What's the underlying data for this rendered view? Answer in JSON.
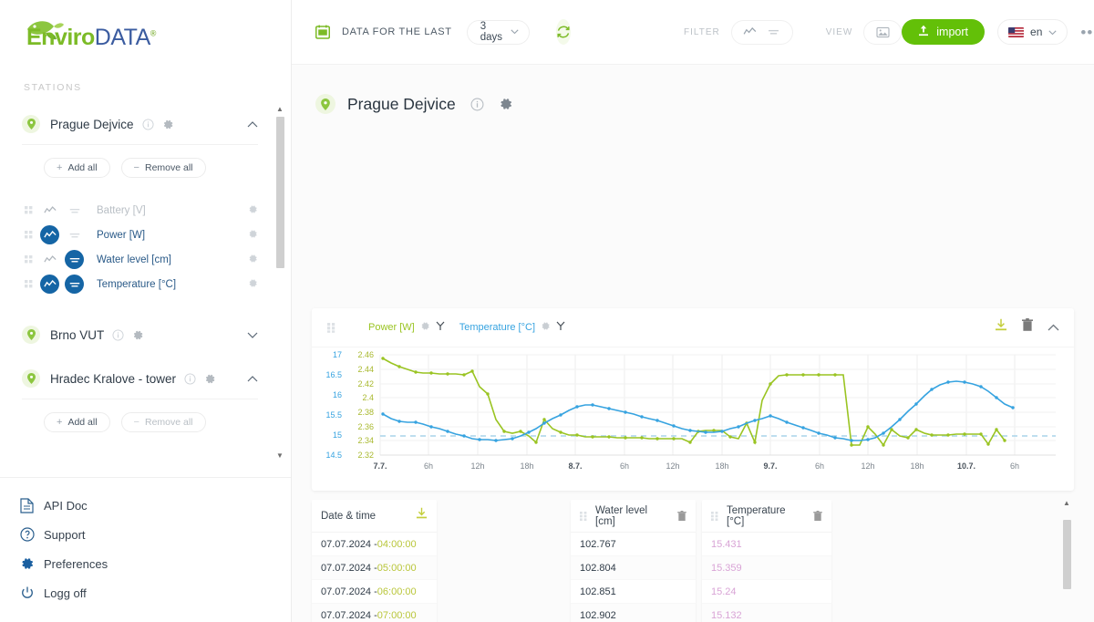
{
  "brand": {
    "enviro": "Enviro",
    "data": "DATA",
    "reg": "®"
  },
  "sidebar": {
    "stations_label": "STATIONS",
    "stations": [
      {
        "name": "Prague Dejvice",
        "expanded": true,
        "add_all": "Add all",
        "remove_all": "Remove all",
        "sensors": [
          {
            "label": "Battery [V]",
            "chart_on": false,
            "table_on": false,
            "active": false
          },
          {
            "label": "Power [W]",
            "chart_on": true,
            "table_on": false,
            "active": true
          },
          {
            "label": "Water level [cm]",
            "chart_on": false,
            "table_on": true,
            "active": true
          },
          {
            "label": "Temperature [°C]",
            "chart_on": true,
            "table_on": true,
            "active": true
          }
        ]
      },
      {
        "name": "Brno VUT",
        "expanded": false,
        "sensors": []
      },
      {
        "name": "Hradec Kralove - tower",
        "expanded": true,
        "add_all": "Add all",
        "remove_all": "Remove all",
        "sensors": []
      }
    ],
    "footer": [
      {
        "label": "API Doc",
        "icon": "document-icon"
      },
      {
        "label": "Support",
        "icon": "help-circle-icon"
      },
      {
        "label": "Preferences",
        "icon": "gear-icon"
      },
      {
        "label": "Logg off",
        "icon": "power-icon"
      }
    ]
  },
  "topbar": {
    "data_for_last_label": "DATA FOR THE LAST",
    "range_value": "3 days",
    "refresh_icon": "refresh-icon",
    "filter_label": "FILTER",
    "view_label": "VIEW",
    "import_label": "import",
    "language": "en",
    "kebab": "•••"
  },
  "page": {
    "title": "Prague Dejvice"
  },
  "chart_card": {
    "series_power_label": "Power [W]",
    "series_temp_label": "Temperature [°C]",
    "power_color": "#9ac422",
    "temp_color": "#36a3e0"
  },
  "table": {
    "columns": [
      {
        "key": "datetime",
        "label": "Date & time"
      },
      {
        "key": "water",
        "label": "Water level [cm]"
      },
      {
        "key": "temp",
        "label": "Temperature [°C]"
      }
    ],
    "rows": [
      {
        "date": "07.07.2024 - ",
        "time": "04:00:00",
        "water": "102.767",
        "temp": "15.431"
      },
      {
        "date": "07.07.2024 - ",
        "time": "05:00:00",
        "water": "102.804",
        "temp": "15.359"
      },
      {
        "date": "07.07.2024 - ",
        "time": "06:00:00",
        "water": "102.851",
        "temp": "15.24"
      },
      {
        "date": "07.07.2024 - ",
        "time": "07:00:00",
        "water": "102.902",
        "temp": "15.132"
      }
    ]
  },
  "chart_data": {
    "type": "line",
    "title": "",
    "xlabel": "",
    "grid": true,
    "legend_position": "top-left",
    "x_ticks": [
      "7.7.",
      "6h",
      "12h",
      "18h",
      "8.7.",
      "6h",
      "12h",
      "18h",
      "9.7.",
      "6h",
      "12h",
      "18h",
      "10.7.",
      "6h"
    ],
    "axes": [
      {
        "name": "Temperature [°C]",
        "side": "left-outer",
        "color": "#36a3e0",
        "ticks": [
          "17",
          "16.5",
          "16",
          "15.5",
          "15",
          "14.5"
        ],
        "ylim": [
          14.3,
          17.15
        ]
      },
      {
        "name": "Power [W]",
        "side": "left-inner",
        "color": "#9ac422",
        "ticks": [
          "2.46",
          "2.44",
          "2.42",
          "2.4",
          "2.38",
          "2.36",
          "2.34",
          "2.32"
        ],
        "ylim": [
          2.31,
          2.47
        ]
      }
    ],
    "reference_line": {
      "value": 2.347,
      "axis": "Power [W]",
      "style": "dashed",
      "color": "#b9d9ea"
    },
    "series": [
      {
        "name": "Power [W]",
        "color": "#9ac422",
        "axis": "Power [W]",
        "values": [
          2.45,
          2.444,
          2.438,
          2.434,
          2.431,
          2.43,
          2.43,
          2.429,
          2.429,
          2.428,
          2.428,
          2.433,
          2.411,
          2.4,
          2.364,
          2.348,
          2.345,
          2.348,
          2.341,
          2.332,
          2.365,
          2.352,
          2.346,
          2.342,
          2.342,
          2.34,
          2.34,
          2.34,
          2.34,
          2.339,
          2.339,
          2.339,
          2.339,
          2.338,
          2.338,
          2.338,
          2.337,
          2.338,
          2.333,
          2.348,
          2.349,
          2.35,
          2.349,
          2.34,
          2.338,
          2.36,
          2.333,
          2.392,
          2.415,
          2.427,
          2.429,
          2.429,
          2.429,
          2.429,
          2.429,
          2.429,
          2.429,
          2.429,
          2.33,
          2.33,
          2.355,
          2.346,
          2.33,
          2.352,
          2.343,
          2.34,
          2.352,
          2.347,
          2.344,
          2.344,
          2.344,
          2.345,
          2.345,
          2.345,
          2.345,
          2.345,
          2.331,
          2.352,
          2.336
        ]
      },
      {
        "name": "Temperature [°C]",
        "color": "#36a3e0",
        "axis": "Temperature [°C]",
        "values": [
          15.85,
          15.72,
          15.63,
          15.6,
          15.6,
          15.55,
          15.48,
          15.42,
          15.35,
          15.28,
          15.22,
          15.16,
          15.12,
          15.12,
          15.1,
          15.12,
          15.16,
          15.22,
          15.32,
          15.42,
          15.57,
          15.68,
          15.78,
          15.9,
          16.0,
          16.05,
          16.05,
          16.0,
          15.95,
          15.9,
          15.85,
          15.8,
          15.74,
          15.68,
          15.62,
          15.55,
          15.48,
          15.4,
          15.35,
          15.32,
          15.3,
          15.3,
          15.32,
          15.38,
          15.45,
          15.55,
          15.62,
          15.68,
          15.74,
          15.68,
          15.58,
          15.5,
          15.42,
          15.35,
          15.28,
          15.22,
          15.16,
          15.12,
          15.08,
          15.08,
          15.1,
          15.16,
          15.28,
          15.45,
          15.65,
          15.85,
          16.05,
          16.25,
          16.42,
          16.55,
          16.62,
          16.65,
          16.63,
          16.58,
          16.5,
          16.38,
          16.22,
          16.05,
          15.95
        ]
      }
    ]
  }
}
